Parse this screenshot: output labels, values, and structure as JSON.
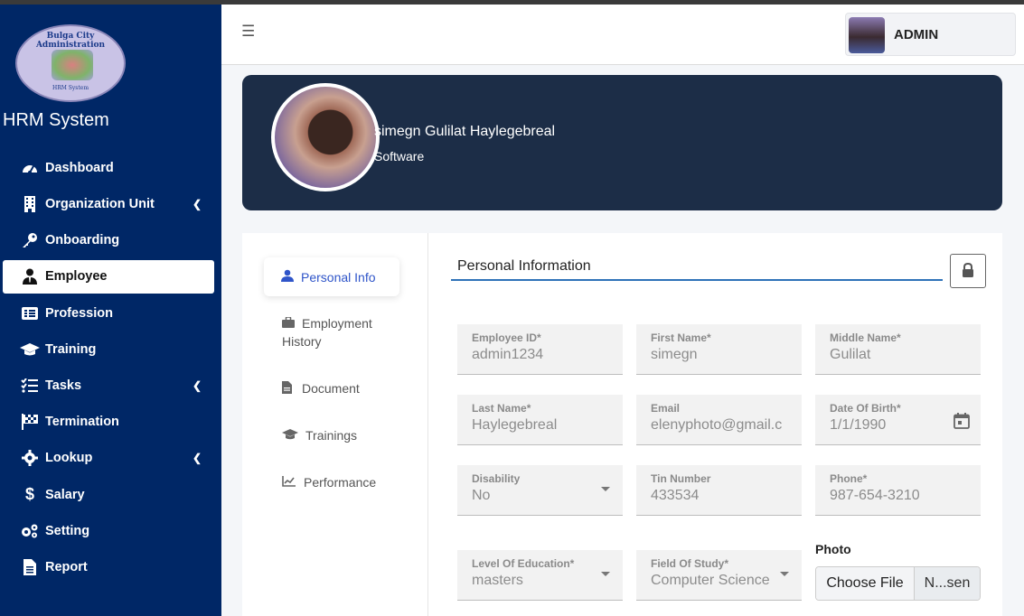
{
  "sidebar": {
    "logo_text": "Bulga City Administration",
    "logo_subtext": "HRM System",
    "brand": "HRM System",
    "items": [
      {
        "label": "Dashboard",
        "icon": "gauge-icon"
      },
      {
        "label": "Organization Unit",
        "icon": "building-icon",
        "has_submenu": true
      },
      {
        "label": "Onboarding",
        "icon": "key-icon"
      },
      {
        "label": "Employee",
        "icon": "user-tie-icon",
        "active": true
      },
      {
        "label": "Profession",
        "icon": "id-card-icon"
      },
      {
        "label": "Training",
        "icon": "graduation-cap-icon"
      },
      {
        "label": "Tasks",
        "icon": "tasks-list-icon",
        "has_submenu": true
      },
      {
        "label": "Termination",
        "icon": "checkered-flag-icon"
      },
      {
        "label": "Lookup",
        "icon": "gear-icon",
        "has_submenu": true
      },
      {
        "label": "Salary",
        "icon": "dollar-icon"
      },
      {
        "label": "Setting",
        "icon": "gears-icon"
      },
      {
        "label": "Report",
        "icon": "file-icon"
      }
    ]
  },
  "header": {
    "menu_icon": "hamburger-icon",
    "user_name": "ADMIN"
  },
  "profile": {
    "full_name": "simegn Gulilat Haylegebreal",
    "role": "Software"
  },
  "tabs": [
    {
      "label": "Personal Info",
      "icon": "user-icon",
      "active": true
    },
    {
      "label_line1": "Employment",
      "label_line2": "History",
      "icon": "briefcase-icon"
    },
    {
      "label": "Document",
      "icon": "file-icon"
    },
    {
      "label": "Trainings",
      "icon": "graduation-cap-icon"
    },
    {
      "label": "Performance",
      "icon": "chart-line-icon"
    }
  ],
  "form": {
    "section_title": "Personal Information",
    "fields": {
      "employee_id": {
        "label": "Employee ID*",
        "value": "admin1234"
      },
      "first_name": {
        "label": "First Name*",
        "value": "simegn"
      },
      "middle_name": {
        "label": "Middle Name*",
        "value": "Gulilat"
      },
      "last_name": {
        "label": "Last Name*",
        "value": "Haylegebreal"
      },
      "email": {
        "label": "Email",
        "value": "elenyphoto@gmail.c"
      },
      "dob": {
        "label": "Date Of Birth*",
        "value": "1/1/1990"
      },
      "disability": {
        "label": "Disability",
        "value": "No"
      },
      "tin": {
        "label": "Tin Number",
        "value": "433534"
      },
      "phone": {
        "label": "Phone*",
        "value": "987-654-3210"
      },
      "education": {
        "label": "Level Of Education*",
        "value": "masters"
      },
      "field_of_study": {
        "label": "Field Of Study*",
        "value": "Computer Science"
      }
    },
    "photo_label": "Photo",
    "choose_file": "Choose File",
    "file_status": "N...sen"
  }
}
